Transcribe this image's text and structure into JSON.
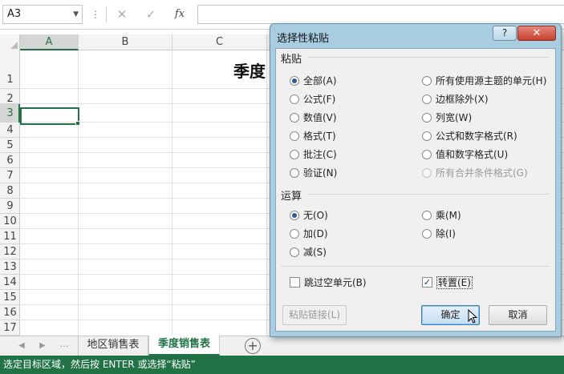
{
  "formula_bar": {
    "name_box": "A3",
    "cancel_glyph": "✕",
    "enter_glyph": "✓",
    "function_glyph": "fx",
    "formula_value": ""
  },
  "grid": {
    "columns": [
      "A",
      "B",
      "C"
    ],
    "rows": [
      "1",
      "2",
      "3",
      "4",
      "5",
      "6",
      "7",
      "8",
      "9",
      "10",
      "11",
      "12",
      "13",
      "14",
      "15",
      "16",
      "17"
    ],
    "selected_cell": "A3",
    "title_fragment": "季度"
  },
  "sheet_tabs": {
    "tabs": [
      "地区销售表",
      "季度销售表"
    ],
    "active": "季度销售表",
    "add_glyph": "+"
  },
  "status_bar": {
    "text": "选定目标区域，然后按 ENTER 或选择“粘贴”"
  },
  "dialog": {
    "title": "选择性粘贴",
    "help_label": "?",
    "close_label": "✕",
    "paste_group": {
      "label": "粘贴",
      "left_options": [
        "全部(A)",
        "公式(F)",
        "数值(V)",
        "格式(T)",
        "批注(C)",
        "验证(N)"
      ],
      "right_options": [
        "所有使用源主题的单元(H)",
        "边框除外(X)",
        "列宽(W)",
        "公式和数字格式(R)",
        "值和数字格式(U)",
        "所有合并条件格式(G)"
      ],
      "selected": "全部(A)",
      "disabled": "所有合并条件格式(G)"
    },
    "operation_group": {
      "label": "运算",
      "left_options": [
        "无(O)",
        "加(D)",
        "减(S)"
      ],
      "right_options": [
        "乘(M)",
        "除(I)"
      ],
      "selected": "无(O)"
    },
    "skip_blanks": {
      "label": "跳过空单元(B)",
      "checked": false
    },
    "transpose": {
      "label": "转置(E)",
      "checked": true
    },
    "buttons": {
      "paste_link": "粘贴链接(L)",
      "ok": "确定",
      "cancel": "取消"
    }
  },
  "colors": {
    "excel_green": "#217346",
    "dialog_frame": "#a8cde0",
    "close_red": "#c7412f"
  }
}
